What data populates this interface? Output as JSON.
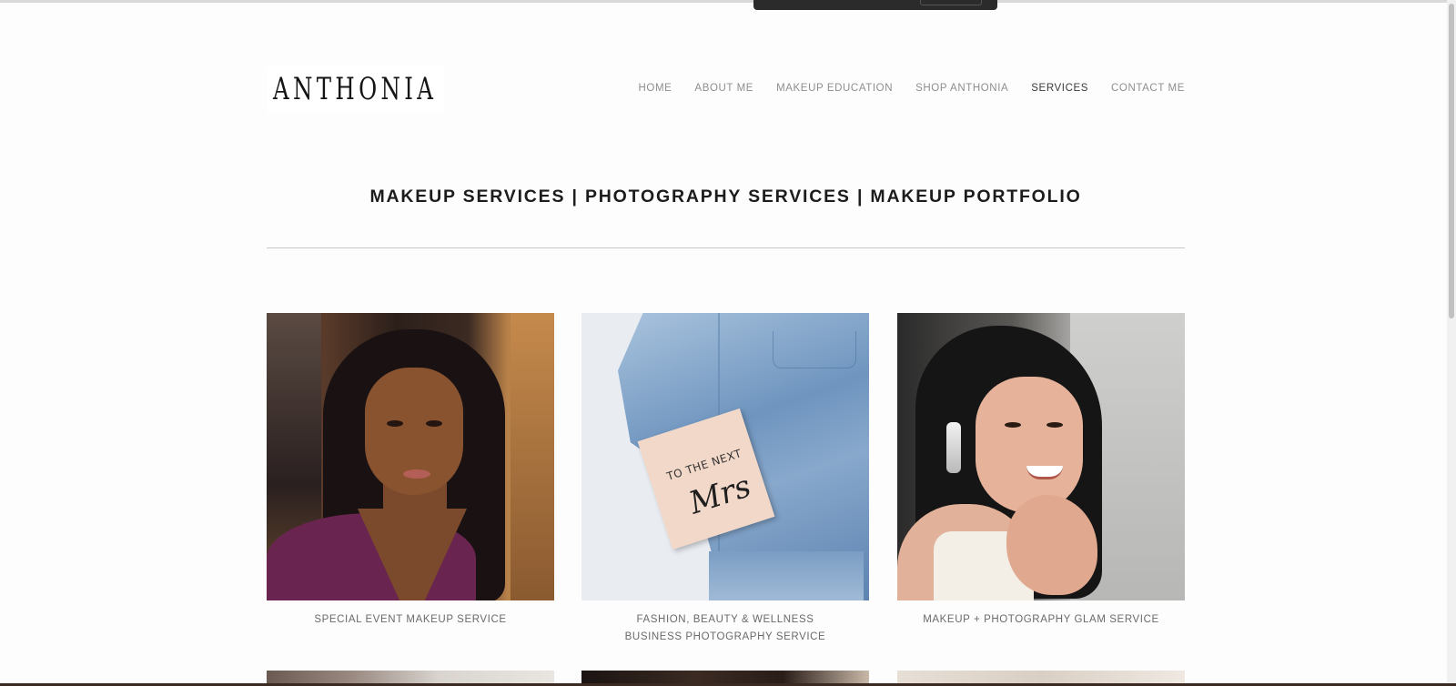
{
  "header": {
    "logo_text": "ANTHONIA",
    "nav": [
      {
        "label": "HOME",
        "active": false
      },
      {
        "label": "ABOUT ME",
        "active": false
      },
      {
        "label": "MAKEUP EDUCATION",
        "active": false
      },
      {
        "label": "SHOP ANTHONIA",
        "active": false
      },
      {
        "label": "SERVICES",
        "active": true
      },
      {
        "label": "CONTACT ME",
        "active": false
      }
    ]
  },
  "page": {
    "title": "MAKEUP SERVICES | PHOTOGRAPHY SERVICES | MAKEUP PORTFOLIO"
  },
  "services": [
    {
      "caption": "SPECIAL EVENT MAKEUP SERVICE"
    },
    {
      "caption": "FASHION, BEAUTY & WELLNESS BUSINESS PHOTOGRAPHY SERVICE",
      "note_text": "TO THE NEXT",
      "note_script": "Mrs"
    },
    {
      "caption": "MAKEUP + PHOTOGRAPHY GLAM SERVICE"
    }
  ],
  "colors": {
    "background": "#fdfdfd",
    "nav_text": "#8e8e8e",
    "nav_active": "#3a3a3a",
    "title_text": "#1c1c1c",
    "divider": "#c8c8c8"
  }
}
